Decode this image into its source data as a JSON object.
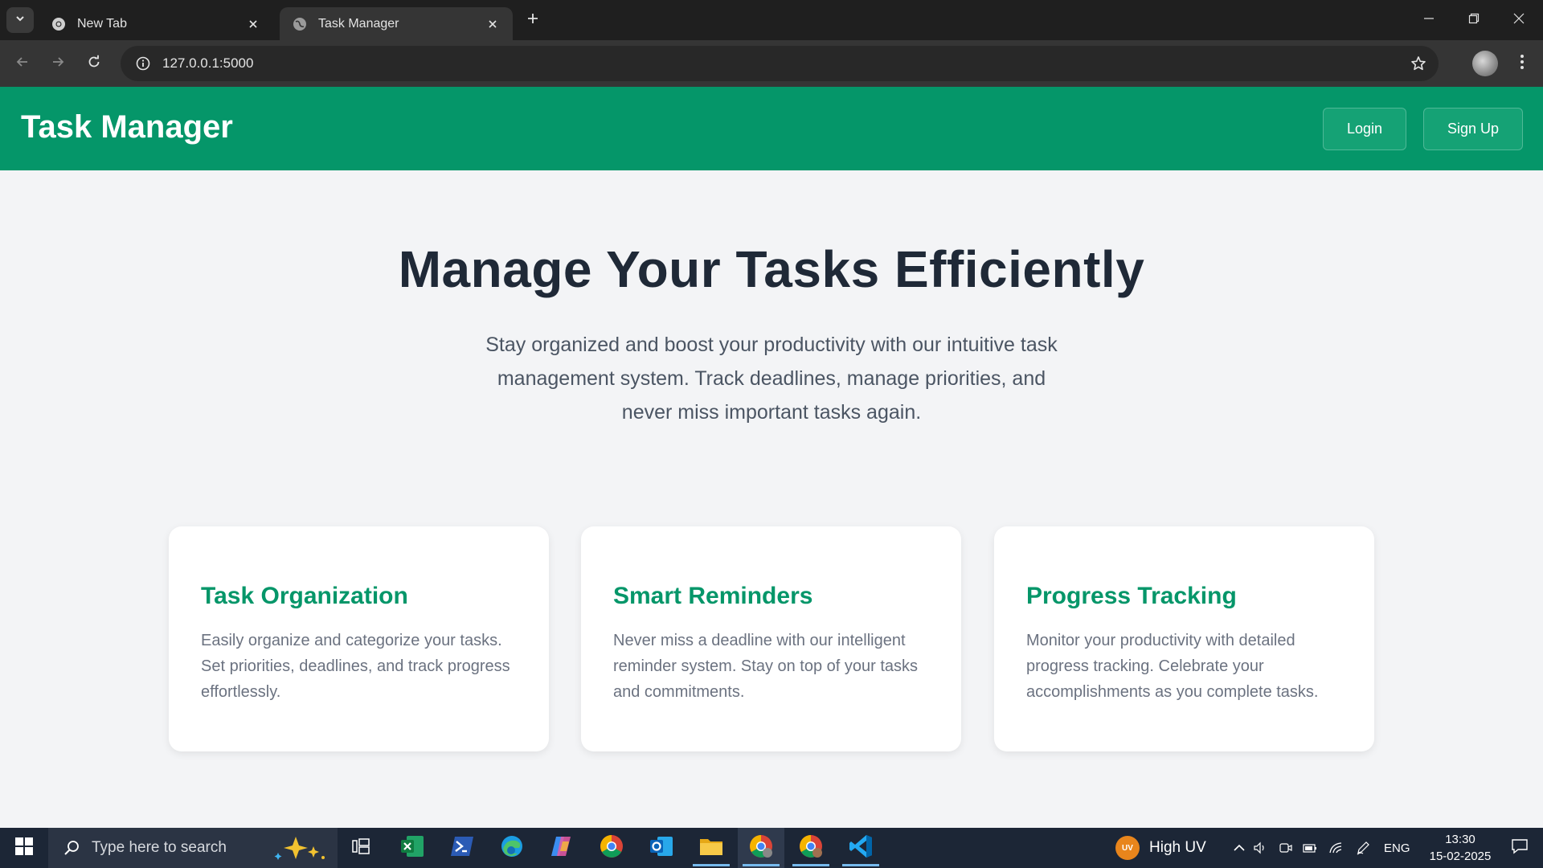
{
  "browser": {
    "tabs": [
      {
        "title": "New Tab",
        "active": false
      },
      {
        "title": "Task Manager",
        "active": true
      }
    ],
    "url": "127.0.0.1:5000"
  },
  "header": {
    "brand": "Task Manager",
    "login_label": "Login",
    "signup_label": "Sign Up"
  },
  "hero": {
    "title": "Manage Your Tasks Efficiently",
    "subtitle": "Stay organized and boost your productivity with our intuitive task management system. Track deadlines, manage priorities, and never miss important tasks again."
  },
  "features": [
    {
      "title": "Task Organization",
      "description": "Easily organize and categorize your tasks. Set priorities, deadlines, and track progress effortlessly."
    },
    {
      "title": "Smart Reminders",
      "description": "Never miss a deadline with our intelligent reminder system. Stay on top of your tasks and commitments."
    },
    {
      "title": "Progress Tracking",
      "description": "Monitor your productivity with detailed progress tracking. Celebrate your accomplishments as you complete tasks."
    }
  ],
  "taskbar": {
    "search_placeholder": "Type here to search",
    "apps": [
      "task-view",
      "excel",
      "powershell",
      "edge",
      "copilot",
      "chrome",
      "outlook",
      "file-explorer",
      "chrome-profile",
      "chrome",
      "vscode"
    ],
    "weather_badge": "UV",
    "weather_text": "High UV",
    "language": "ENG",
    "time": "13:30",
    "date": "15-02-2025"
  },
  "colors": {
    "brand": "#059669",
    "heading": "#1f2937",
    "body_text": "#6b7280",
    "page_bg": "#f3f4f6"
  }
}
